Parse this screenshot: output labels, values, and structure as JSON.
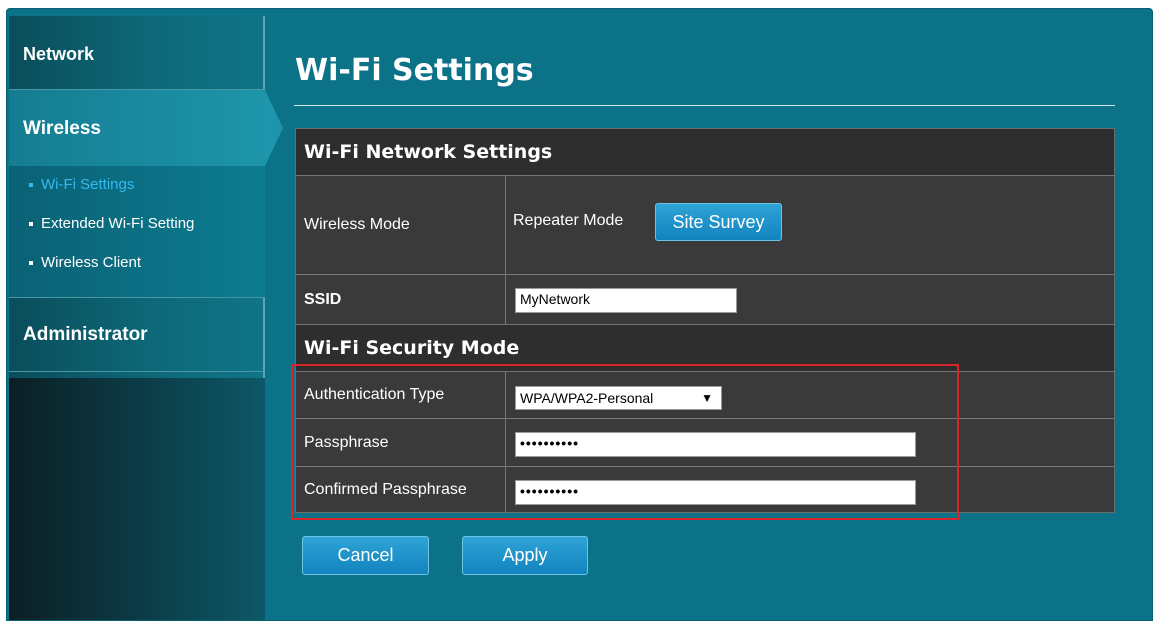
{
  "sidebar": {
    "network": "Network",
    "wireless": "Wireless",
    "wireless_items": [
      "Wi-Fi Settings",
      "Extended Wi-Fi Setting",
      "Wireless Client"
    ],
    "administrator": "Administrator"
  },
  "page": {
    "title": "Wi-Fi Settings"
  },
  "network_settings": {
    "heading": "Wi-Fi Network Settings",
    "wireless_mode_label": "Wireless Mode",
    "wireless_mode_value": "Repeater Mode",
    "site_survey_button": "Site Survey",
    "ssid_label": "SSID",
    "ssid_value": "MyNetwork"
  },
  "security": {
    "heading": "Wi-Fi Security Mode",
    "auth_type_label": "Authentication Type",
    "auth_type_value": "WPA/WPA2-Personal",
    "passphrase_label": "Passphrase",
    "passphrase_value": "••••••••••",
    "confirm_label": "Confirmed Passphrase",
    "confirm_value": "••••••••••"
  },
  "actions": {
    "cancel": "Cancel",
    "apply": "Apply"
  },
  "colors": {
    "background": "#0c7287",
    "accent": "#1283bf",
    "active_link": "#35b8f0",
    "highlight_box": "#d9252a"
  }
}
